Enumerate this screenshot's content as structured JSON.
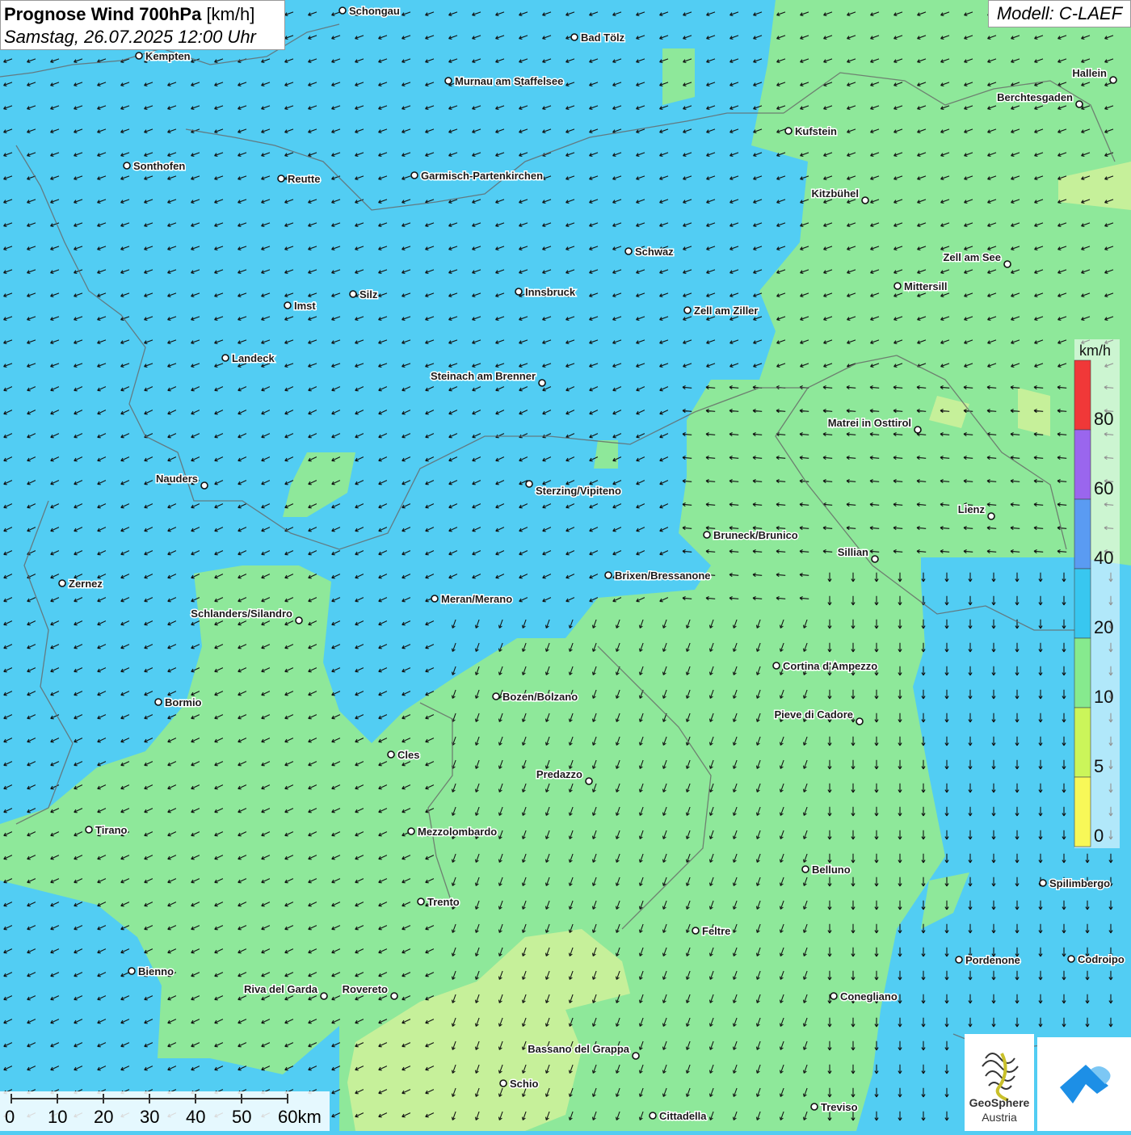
{
  "header": {
    "title_bold": "Prognose Wind 700hPa",
    "title_unit": "[km/h]",
    "datetime": "Samstag, 26.07.2025 12:00 Uhr"
  },
  "model": {
    "label": "Modell: C-LAEF"
  },
  "legend": {
    "unit": "km/h",
    "steps": [
      {
        "label": "80",
        "color": "#f03838"
      },
      {
        "label": "60",
        "color": "#9a66ee"
      },
      {
        "label": "40",
        "color": "#5a9bf2"
      },
      {
        "label": "20",
        "color": "#38c7f0"
      },
      {
        "label": "10",
        "color": "#86ea8e"
      },
      {
        "label": "5",
        "color": "#cbf55a"
      },
      {
        "label": "0",
        "color": "#f8f858"
      }
    ]
  },
  "scale": {
    "labels": [
      "0",
      "10",
      "20",
      "30",
      "40",
      "50",
      "60km"
    ]
  },
  "logos": {
    "geosphere_line1": "GeoSphere",
    "geosphere_line2": "Austria"
  },
  "colors": {
    "strong_wind": "#52cdf3",
    "moderate_wind": "#8ee89a",
    "light_wind": "#c6f09a"
  },
  "cities": [
    {
      "name": "Schongau",
      "label_side": "right"
    },
    {
      "name": "Bad Tölz",
      "label_side": "right"
    },
    {
      "name": "Kempten",
      "label_side": "right"
    },
    {
      "name": "Murnau am Staffelsee",
      "label_side": "right"
    },
    {
      "name": "Hallein",
      "label_side": "left"
    },
    {
      "name": "Berchtesgaden",
      "label_side": "left"
    },
    {
      "name": "Kufstein",
      "label_side": "right"
    },
    {
      "name": "Sonthofen",
      "label_side": "right"
    },
    {
      "name": "Reutte",
      "label_side": "right"
    },
    {
      "name": "Garmisch-Partenkirchen",
      "label_side": "right"
    },
    {
      "name": "Kitzbühel",
      "label_side": "left"
    },
    {
      "name": "Schwaz",
      "label_side": "right"
    },
    {
      "name": "Zell am See",
      "label_side": "left"
    },
    {
      "name": "Mittersill",
      "label_side": "right"
    },
    {
      "name": "Innsbruck",
      "label_side": "right"
    },
    {
      "name": "Silz",
      "label_side": "right"
    },
    {
      "name": "Imst",
      "label_side": "right"
    },
    {
      "name": "Zell am Ziller",
      "label_side": "right"
    },
    {
      "name": "Landeck",
      "label_side": "right"
    },
    {
      "name": "Steinach am Brenner",
      "label_side": "left"
    },
    {
      "name": "Matrei in Osttirol",
      "label_side": "left"
    },
    {
      "name": "Nauders",
      "label_side": "left"
    },
    {
      "name": "Sterzing/Vipiteno",
      "label_side": "below"
    },
    {
      "name": "Lienz",
      "label_side": "left"
    },
    {
      "name": "Bruneck/Brunico",
      "label_side": "right"
    },
    {
      "name": "Sillian",
      "label_side": "left"
    },
    {
      "name": "Brixen/Bressanone",
      "label_side": "right"
    },
    {
      "name": "Zernez",
      "label_side": "right"
    },
    {
      "name": "Meran/Merano",
      "label_side": "right"
    },
    {
      "name": "Schlanders/Silandro",
      "label_side": "left"
    },
    {
      "name": "Cortina d'Ampezzo",
      "label_side": "right"
    },
    {
      "name": "Bozen/Bolzano",
      "label_side": "right"
    },
    {
      "name": "Bormio",
      "label_side": "right"
    },
    {
      "name": "Pieve di Cadore",
      "label_side": "left"
    },
    {
      "name": "Cles",
      "label_side": "right"
    },
    {
      "name": "Predazzo",
      "label_side": "left"
    },
    {
      "name": "Tirano",
      "label_side": "right"
    },
    {
      "name": "Mezzolombardo",
      "label_side": "right"
    },
    {
      "name": "Belluno",
      "label_side": "right"
    },
    {
      "name": "Spilimbergo",
      "label_side": "right"
    },
    {
      "name": "Trento",
      "label_side": "right"
    },
    {
      "name": "Feltre",
      "label_side": "right"
    },
    {
      "name": "Pordenone",
      "label_side": "right"
    },
    {
      "name": "Codroipo",
      "label_side": "right"
    },
    {
      "name": "Bienno",
      "label_side": "right"
    },
    {
      "name": "Riva del Garda",
      "label_side": "left"
    },
    {
      "name": "Rovereto",
      "label_side": "left"
    },
    {
      "name": "Conegliano",
      "label_side": "right"
    },
    {
      "name": "Bassano del Grappa",
      "label_side": "left"
    },
    {
      "name": "Schio",
      "label_side": "right"
    },
    {
      "name": "Treviso",
      "label_side": "right"
    },
    {
      "name": "Cittadella",
      "label_side": "right"
    }
  ]
}
